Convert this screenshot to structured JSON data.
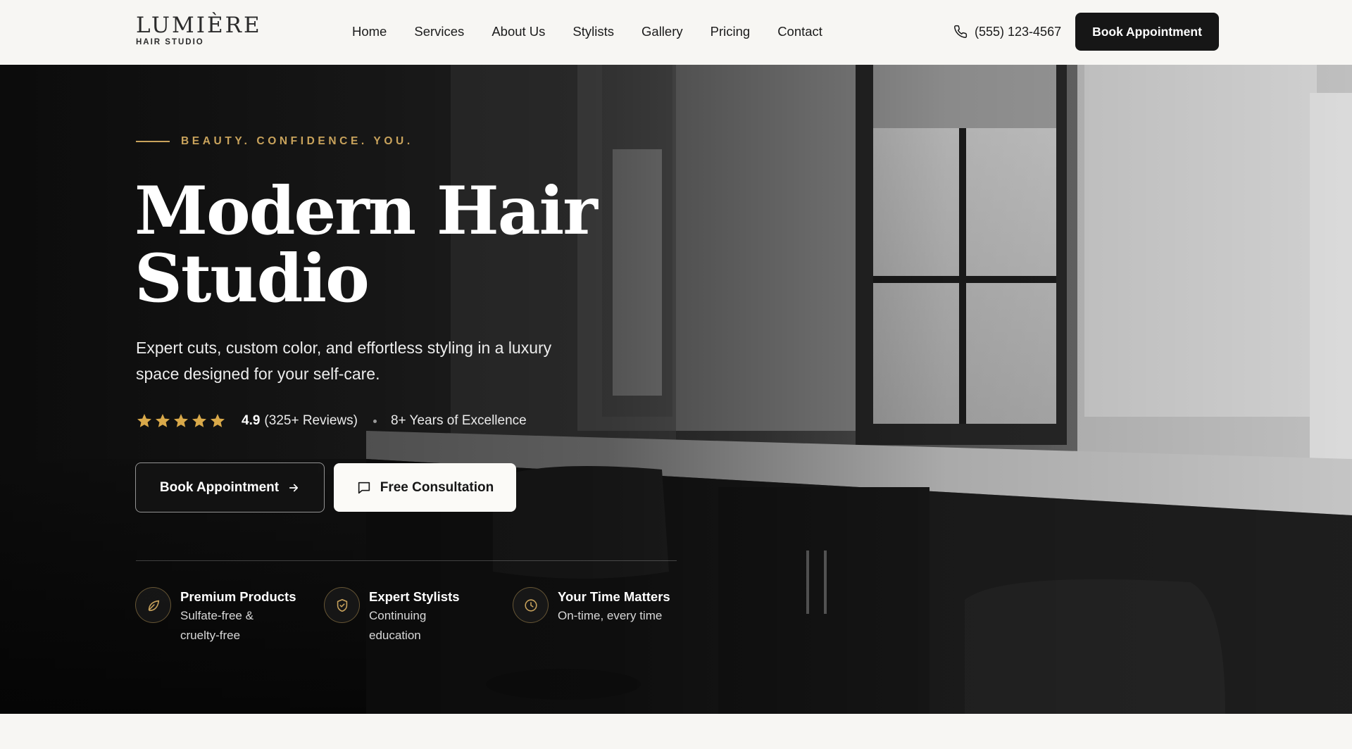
{
  "brand": {
    "name": "LUMIÈRE",
    "subtitle": "HAIR STUDIO"
  },
  "nav": {
    "items": [
      "Home",
      "Services",
      "About Us",
      "Stylists",
      "Gallery",
      "Pricing",
      "Contact"
    ]
  },
  "header": {
    "phone": "(555) 123-4567",
    "cta_label": "Book Appointment"
  },
  "hero": {
    "tagline": "BEAUTY. CONFIDENCE. YOU.",
    "title_line1": "Modern Hair",
    "title_line2": "Studio",
    "description": "Expert cuts, custom color, and effortless styling in a luxury space designed for your self-care.",
    "rating": {
      "stars": 5,
      "score": "4.9",
      "reviews": "(325+ Reviews)"
    },
    "experience": "8+ Years of Excellence",
    "primary_cta": "Book Appointment",
    "secondary_cta": "Free Consultation",
    "features": [
      {
        "icon": "leaf-icon",
        "title": "Premium Products",
        "desc_line1": "Sulfate-free &",
        "desc_line2": "cruelty-free"
      },
      {
        "icon": "shield-check-icon",
        "title": "Expert Stylists",
        "desc_line1": "Continuing",
        "desc_line2": "education"
      },
      {
        "icon": "clock-icon",
        "title": "Your Time Matters",
        "desc_line1": "On-time, every time",
        "desc_line2": ""
      }
    ]
  },
  "colors": {
    "accent_gold": "#c9a35c",
    "dark": "#161616",
    "page_bg": "#f7f6f3",
    "star": "#d9a94a"
  }
}
